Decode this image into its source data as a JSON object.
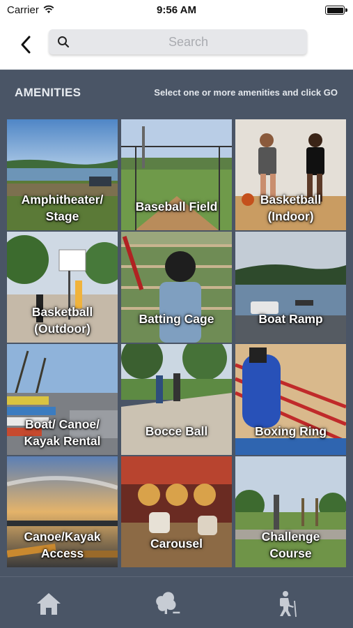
{
  "status_bar": {
    "carrier": "Carrier",
    "time": "9:56 AM"
  },
  "nav": {
    "back_icon": "chevron-left-icon",
    "search_placeholder": "Search",
    "search_value": ""
  },
  "header": {
    "title": "AMENITIES",
    "hint": "Select one or more amenities and click GO"
  },
  "amenities": [
    {
      "line1": "Amphitheater/",
      "line2": "Stage"
    },
    {
      "line1": "Baseball Field",
      "line2": ""
    },
    {
      "line1": "Basketball",
      "line2": "(Indoor)"
    },
    {
      "line1": "Basketball",
      "line2": "(Outdoor)"
    },
    {
      "line1": "Batting Cage",
      "line2": ""
    },
    {
      "line1": "Boat Ramp",
      "line2": ""
    },
    {
      "line1": "Boat/ Canoe/",
      "line2": "Kayak Rental"
    },
    {
      "line1": "Bocce Ball",
      "line2": ""
    },
    {
      "line1": "Boxing Ring",
      "line2": ""
    },
    {
      "line1": "Canoe/Kayak",
      "line2": "Access"
    },
    {
      "line1": "Carousel",
      "line2": ""
    },
    {
      "line1": "Challenge",
      "line2": "Course"
    }
  ],
  "tab_bar": {
    "icons": [
      "home-icon",
      "tree-icon",
      "hiker-icon"
    ]
  },
  "colors": {
    "background": "#4a5566",
    "nav_background": "#ffffff",
    "label": "#ffffff"
  }
}
